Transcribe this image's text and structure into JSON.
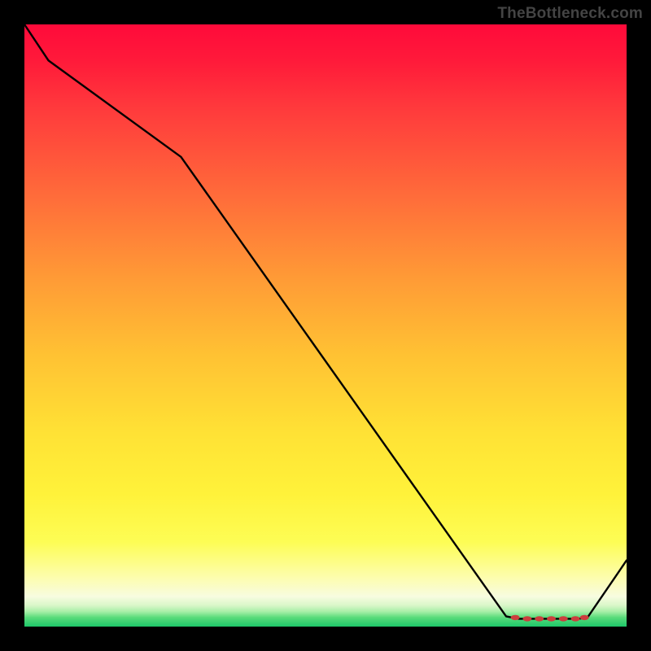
{
  "watermark": "TheBottleneck.com",
  "chart_data": {
    "type": "line",
    "x": [
      0.0,
      0.04,
      0.26,
      0.8,
      0.82,
      0.84,
      0.86,
      0.88,
      0.9,
      0.92,
      0.935,
      1.0
    ],
    "y": [
      1.0,
      0.94,
      0.78,
      0.017,
      0.013,
      0.013,
      0.013,
      0.013,
      0.013,
      0.013,
      0.015,
      0.11
    ],
    "xlim": [
      0,
      1
    ],
    "ylim": [
      0,
      1
    ],
    "title": "",
    "xlabel": "",
    "ylabel": "",
    "grid": false,
    "legend": false,
    "note": "Single black curve over vertical red→green gradient; small red dotted segment along minimum trough. Axes not labeled; values are normalized 0–1 estimates from pixel positions."
  },
  "trough_markers": {
    "x": [
      0.815,
      0.835,
      0.855,
      0.875,
      0.895,
      0.915,
      0.93
    ],
    "y": [
      0.015,
      0.013,
      0.013,
      0.013,
      0.013,
      0.013,
      0.015
    ]
  },
  "colors": {
    "curve": "#000000",
    "marker": "#cc3e3e",
    "frame_bg": "#000000"
  }
}
